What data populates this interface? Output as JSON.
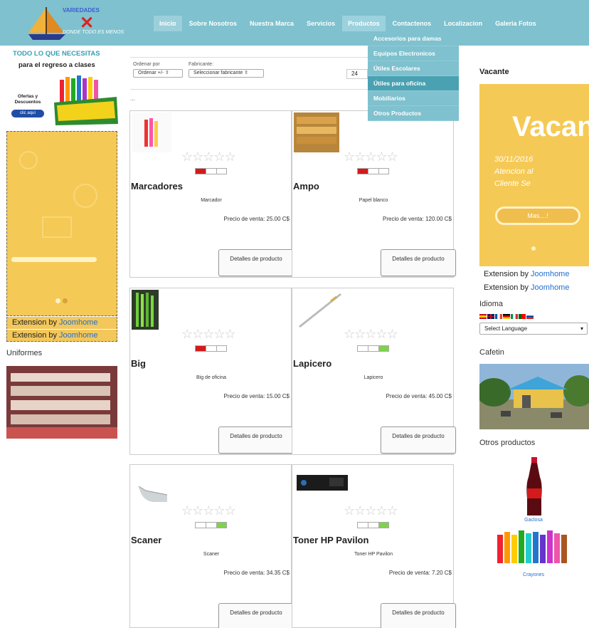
{
  "header": {
    "brand_top": "VARIEDADES",
    "brand_tag": "DONDE TODO ES MENOS",
    "nav": [
      "Inicio",
      "Sobre Nosotros",
      "Nuestra Marca",
      "Servicios",
      "Productos",
      "Contactenos",
      "Localizacion",
      "Galeria Fotos"
    ]
  },
  "dropdown": [
    "Accesorios para damas",
    "Equipos Electronicos",
    "Útiles Escolares",
    "Útiles para oficina",
    "Mobiliarios",
    "Otros Productos"
  ],
  "promo": {
    "line1": "TODO LO QUE NECESITAS",
    "line2": "para el regreso a clases",
    "offer": "Ofertas y Descuentos",
    "button": "clic aquí"
  },
  "extension": {
    "text": "Extension by ",
    "link": "Joomhome"
  },
  "uniformes_title": "Uniformes",
  "toolbar": {
    "order_label": "Ordenar por",
    "order_value": "Ordenar +/- ⇳",
    "manufacturer_label": "Fabricante:",
    "manufacturer_value": "Seleccionar fabricante ⇳",
    "limit": "24",
    "dots": "..."
  },
  "products": [
    {
      "name": "Marcadores",
      "desc": "Marcador",
      "price_label": "Precio de venta:",
      "price": "25.00 C$",
      "stock": "low",
      "details": "Detalles de producto"
    },
    {
      "name": "Ampo",
      "desc": "Papel blanco",
      "price_label": "Precio de venta:",
      "price": "120.00 C$",
      "stock": "low",
      "details": "Detalles de producto"
    },
    {
      "name": "Big",
      "desc": "Big de oficina",
      "price_label": "Precio de venta:",
      "price": "15.00 C$",
      "stock": "low",
      "details": "Detalles de producto"
    },
    {
      "name": "Lapicero",
      "desc": "Lapicero",
      "price_label": "Precio de venta:",
      "price": "45.00 C$",
      "stock": "high",
      "details": "Detalles de producto"
    },
    {
      "name": "Scaner",
      "desc": "Scaner",
      "price_label": "Precio de venta:",
      "price": "34.35 C$",
      "stock": "high",
      "details": "Detalles de producto"
    },
    {
      "name": "Toner HP Pavilon",
      "desc": "Toner HP Pavilon",
      "price_label": "Precio de venta:",
      "price": "7.20 C$",
      "stock": "high",
      "details": "Detalles de producto"
    }
  ],
  "vacante": {
    "title": "Vacante",
    "big": "Vacan",
    "date": "30/11/2016",
    "line2": "Atencion al",
    "line3": "Cliente Se",
    "more": "Mas....!"
  },
  "idioma": {
    "title": "Idioma",
    "select": "Select Language"
  },
  "cafetin_title": "Cafetin",
  "otros": {
    "title": "Otros productos",
    "item1": "Gaclosa",
    "item2": "Crayones"
  },
  "colors": {
    "header": "#7fc1ce",
    "slider": "#f5c955",
    "link": "#1f6fcf",
    "stock_low": "#d41a1a",
    "stock_high": "#7fd24a"
  }
}
